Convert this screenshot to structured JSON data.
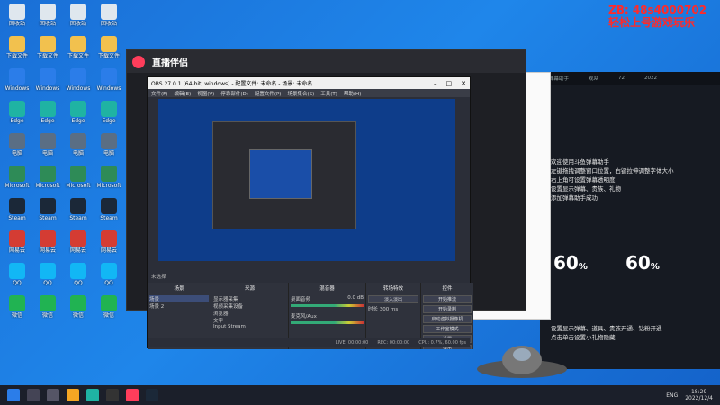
{
  "watermark": {
    "line1": "ZB: 48s4000702",
    "line2": "轻松上号游戏玩乐"
  },
  "desktop": {
    "icons": [
      {
        "label": "回收站",
        "color": "#dfe7ee"
      },
      {
        "label": "下载文件",
        "color": "#f2c14e"
      },
      {
        "label": "Windows",
        "color": "#2b7de9"
      },
      {
        "label": "Edge",
        "color": "#1fb3a3"
      },
      {
        "label": "电脑",
        "color": "#5a6e84"
      },
      {
        "label": "Microsoft",
        "color": "#2e8b57"
      },
      {
        "label": "Steam",
        "color": "#1b2838"
      },
      {
        "label": "网易云",
        "color": "#d43c33"
      },
      {
        "label": "QQ",
        "color": "#12b7f5"
      },
      {
        "label": "微信",
        "color": "#21b352"
      }
    ]
  },
  "app": {
    "name": "直播伴侣"
  },
  "obs": {
    "title": "OBS 27.0.1 (64-bit, windows) - 配置文件: 未命名 - 场景: 未命名",
    "menu": [
      "文件(F)",
      "编辑(E)",
      "视图(V)",
      "停靠部件(D)",
      "配置文件(P)",
      "场景集合(S)",
      "工具(T)",
      "帮助(H)"
    ],
    "selected_source": "未选择",
    "docks": {
      "scenes": {
        "title": "场景",
        "items": [
          "场景",
          "场景 2"
        ]
      },
      "sources": {
        "title": "来源",
        "items": [
          "显示器采集",
          "视频采集设备",
          "浏览器",
          "文字",
          "Input Stream"
        ]
      },
      "mixer": {
        "title": "混音器",
        "channels": [
          "桌面音频",
          "麦克风/Aux"
        ],
        "level": "0.0 dB"
      },
      "transitions": {
        "title": "转场特效",
        "type": "淡入淡出",
        "duration_label": "时长",
        "duration": "300 ms"
      },
      "controls": {
        "title": "控件",
        "buttons": [
          "开始推流",
          "开始录制",
          "启动虚拟摄像机",
          "工作室模式",
          "设置",
          "退出"
        ]
      }
    },
    "status": {
      "live": "LIVE: 00:00:00",
      "rec": "REC: 00:00:00",
      "cpu": "CPU: 0.7%, 60.00 fps"
    }
  },
  "rightwin": {
    "top_items": [
      "弹幕助手",
      "观众",
      "72",
      "2022"
    ],
    "lines": [
      "欢迎使用斗鱼弹幕助手",
      "左键拖拽调整窗口位置，右键拉伸调整字体大小",
      "右上角可设置弹幕透明度",
      "设置显示弹幕、贵族、礼物",
      "添加弹幕助手成功"
    ],
    "pct1": "60",
    "pct2": "60",
    "lines2": [
      "设置显示弹幕、道具、贵族开通、钻粉开通",
      "点击单击设置小礼物隐藏"
    ]
  },
  "taskbar": {
    "lang": "ENG",
    "time": "18:29",
    "date": "2022/12/4"
  },
  "colors": {
    "accent": "#ff3d5b",
    "obs_bg": "#2b2e38",
    "desktop": "#1f86ea"
  }
}
